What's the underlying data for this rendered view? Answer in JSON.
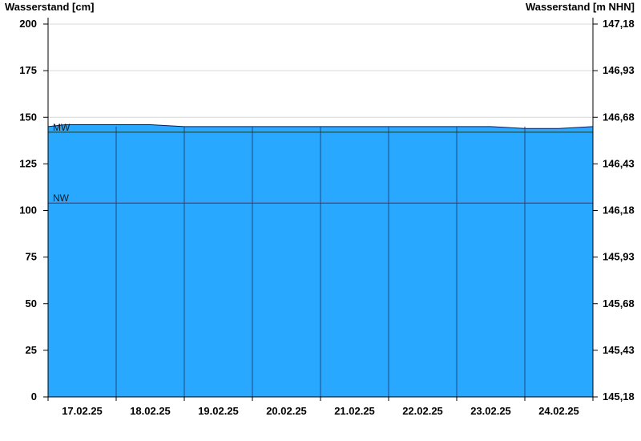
{
  "chart_data": {
    "type": "area",
    "y_left_title": "Wasserstand [cm]",
    "y_right_title": "Wasserstand [m NHN]",
    "y_left_ticks": [
      "0",
      "25",
      "50",
      "75",
      "100",
      "125",
      "150",
      "175",
      "200"
    ],
    "y_right_ticks": [
      "145,18",
      "145,43",
      "145,68",
      "145,93",
      "146,18",
      "146,43",
      "146,68",
      "146,93",
      "147,18"
    ],
    "ylim": [
      0,
      200
    ],
    "x_categories": [
      "17.02.25",
      "18.02.25",
      "19.02.25",
      "20.02.25",
      "21.02.25",
      "22.02.25",
      "23.02.25",
      "24.02.25"
    ],
    "x_start": 0,
    "x_end": 8,
    "grid": true,
    "reference_lines": [
      {
        "label": "MW",
        "value": 142,
        "color": "#1a3a1a"
      },
      {
        "label": "NW",
        "value": 104,
        "color": "#cc0000"
      }
    ],
    "series": [
      {
        "color": "#29a8ff",
        "outline": "#0a1a5c",
        "x": [
          0.0,
          0.25,
          0.5,
          1.0,
          1.5,
          2.0,
          2.5,
          3.0,
          3.5,
          4.0,
          4.5,
          5.0,
          5.5,
          6.0,
          6.5,
          7.0,
          7.5,
          8.0
        ],
        "values": [
          145,
          146,
          146,
          146,
          146,
          145,
          145,
          145,
          145,
          145,
          145,
          145,
          145,
          145,
          145,
          144,
          144,
          145
        ]
      }
    ]
  }
}
